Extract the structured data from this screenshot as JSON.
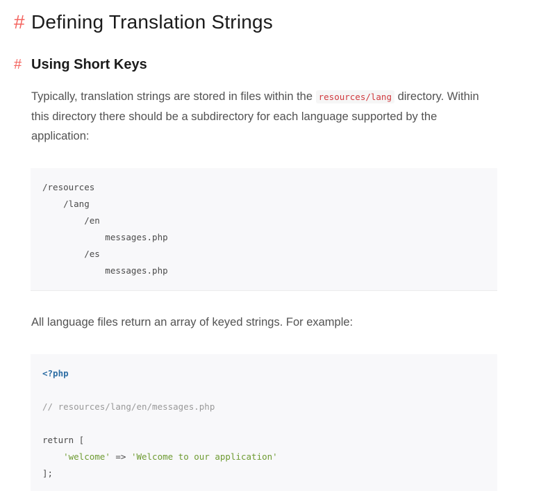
{
  "heading1": {
    "hash": "#",
    "title": "Defining Translation Strings"
  },
  "heading2": {
    "hash": "#",
    "title": "Using Short Keys"
  },
  "paragraph1": {
    "before": "Typically, translation strings are stored in files within the ",
    "code": "resources/lang",
    "after": " directory. Within this directory there should be a subdirectory for each language supported by the application:"
  },
  "dir_tree": [
    "/resources",
    "    /lang",
    "        /en",
    "            messages.php",
    "        /es",
    "            messages.php"
  ],
  "paragraph2": "All language files return an array of keyed strings. For example:",
  "php_example": {
    "open_tag": "<?php",
    "comment": "// resources/lang/en/messages.php",
    "return_line": "return [",
    "indent": "    ",
    "key": "'welcome'",
    "arrow": " => ",
    "value": "'Welcome to our application'",
    "close": "];"
  }
}
